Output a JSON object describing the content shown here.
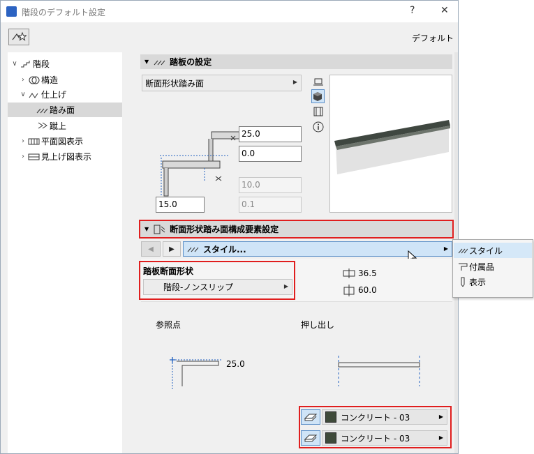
{
  "window": {
    "title": "階段のデフォルト設定",
    "help": "?",
    "close": "✕"
  },
  "toolbar": {
    "default_label": "デフォルト"
  },
  "tree": [
    {
      "label": "階段",
      "indent": 0,
      "chev": "v",
      "selected": false
    },
    {
      "label": "構造",
      "indent": 1,
      "chev": ">",
      "selected": false
    },
    {
      "label": "仕上げ",
      "indent": 1,
      "chev": "v",
      "selected": false
    },
    {
      "label": "踏み面",
      "indent": 2,
      "chev": "",
      "selected": true
    },
    {
      "label": "蹴上",
      "indent": 2,
      "chev": "",
      "selected": false
    },
    {
      "label": "平面図表示",
      "indent": 1,
      "chev": ">",
      "selected": false
    },
    {
      "label": "見上げ図表示",
      "indent": 1,
      "chev": ">",
      "selected": false
    }
  ],
  "tread_section": {
    "title": "踏板の設定",
    "type_dropdown": "断面形状踏み面",
    "fields": {
      "thickness": "25.0",
      "offset": "0.0",
      "nosing_disabled": "10.0",
      "tol_disabled": "0.1",
      "depth": "15.0"
    }
  },
  "profile_section": {
    "title": "断面形状踏み面構成要素設定",
    "style_dropdown": "スタイル...",
    "profile_label": "踏板断面形状",
    "profile_dropdown": "階段-ノンスリップ",
    "width": "36.5",
    "height": "60.0",
    "ref_point_label": "参照点",
    "extrude_label": "押し出し",
    "ref_value": "25.0"
  },
  "materials": [
    {
      "label": "コンクリート - 03",
      "color": "#3f4a3a"
    },
    {
      "label": "コンクリート - 03",
      "color": "#3f4a3a"
    }
  ],
  "popup_menu": [
    {
      "label": "スタイル",
      "highlighted": true
    },
    {
      "label": "付属品",
      "highlighted": false
    },
    {
      "label": "表示",
      "highlighted": false
    }
  ]
}
